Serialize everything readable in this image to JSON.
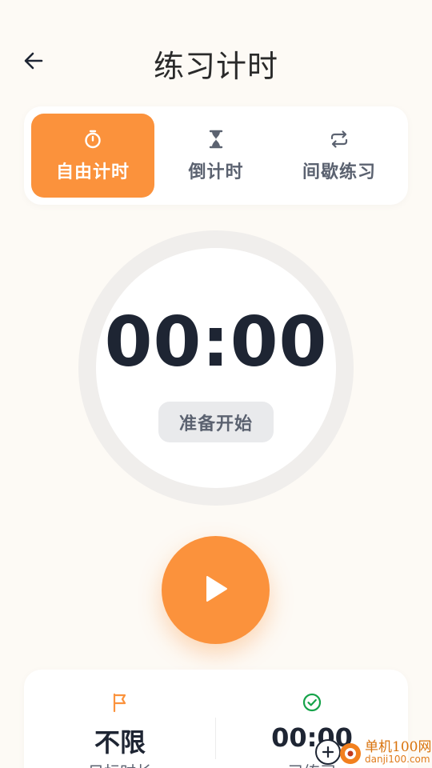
{
  "header": {
    "title": "练习计时",
    "back_icon": "arrow-left-icon"
  },
  "modes": [
    {
      "label": "自由计时",
      "icon": "stopwatch-icon",
      "active": true
    },
    {
      "label": "倒计时",
      "icon": "hourglass-icon",
      "active": false
    },
    {
      "label": "间歇练习",
      "icon": "repeat-icon",
      "active": false
    }
  ],
  "timer": {
    "time": "00:00",
    "status": "准备开始"
  },
  "controls": {
    "play_icon": "play-icon"
  },
  "stats": [
    {
      "value": "不限",
      "label": "目标时长",
      "icon": "flag-icon"
    },
    {
      "value": "00:00",
      "label": "已练习",
      "icon": "check-circle-icon"
    }
  ],
  "watermark": {
    "title": "单机100网",
    "url": "danji100.com"
  },
  "colors": {
    "accent": "#fb923c",
    "background": "#fdfaf5",
    "success": "#16a34a",
    "text_primary": "#1e2533",
    "text_secondary": "#5b6270"
  }
}
